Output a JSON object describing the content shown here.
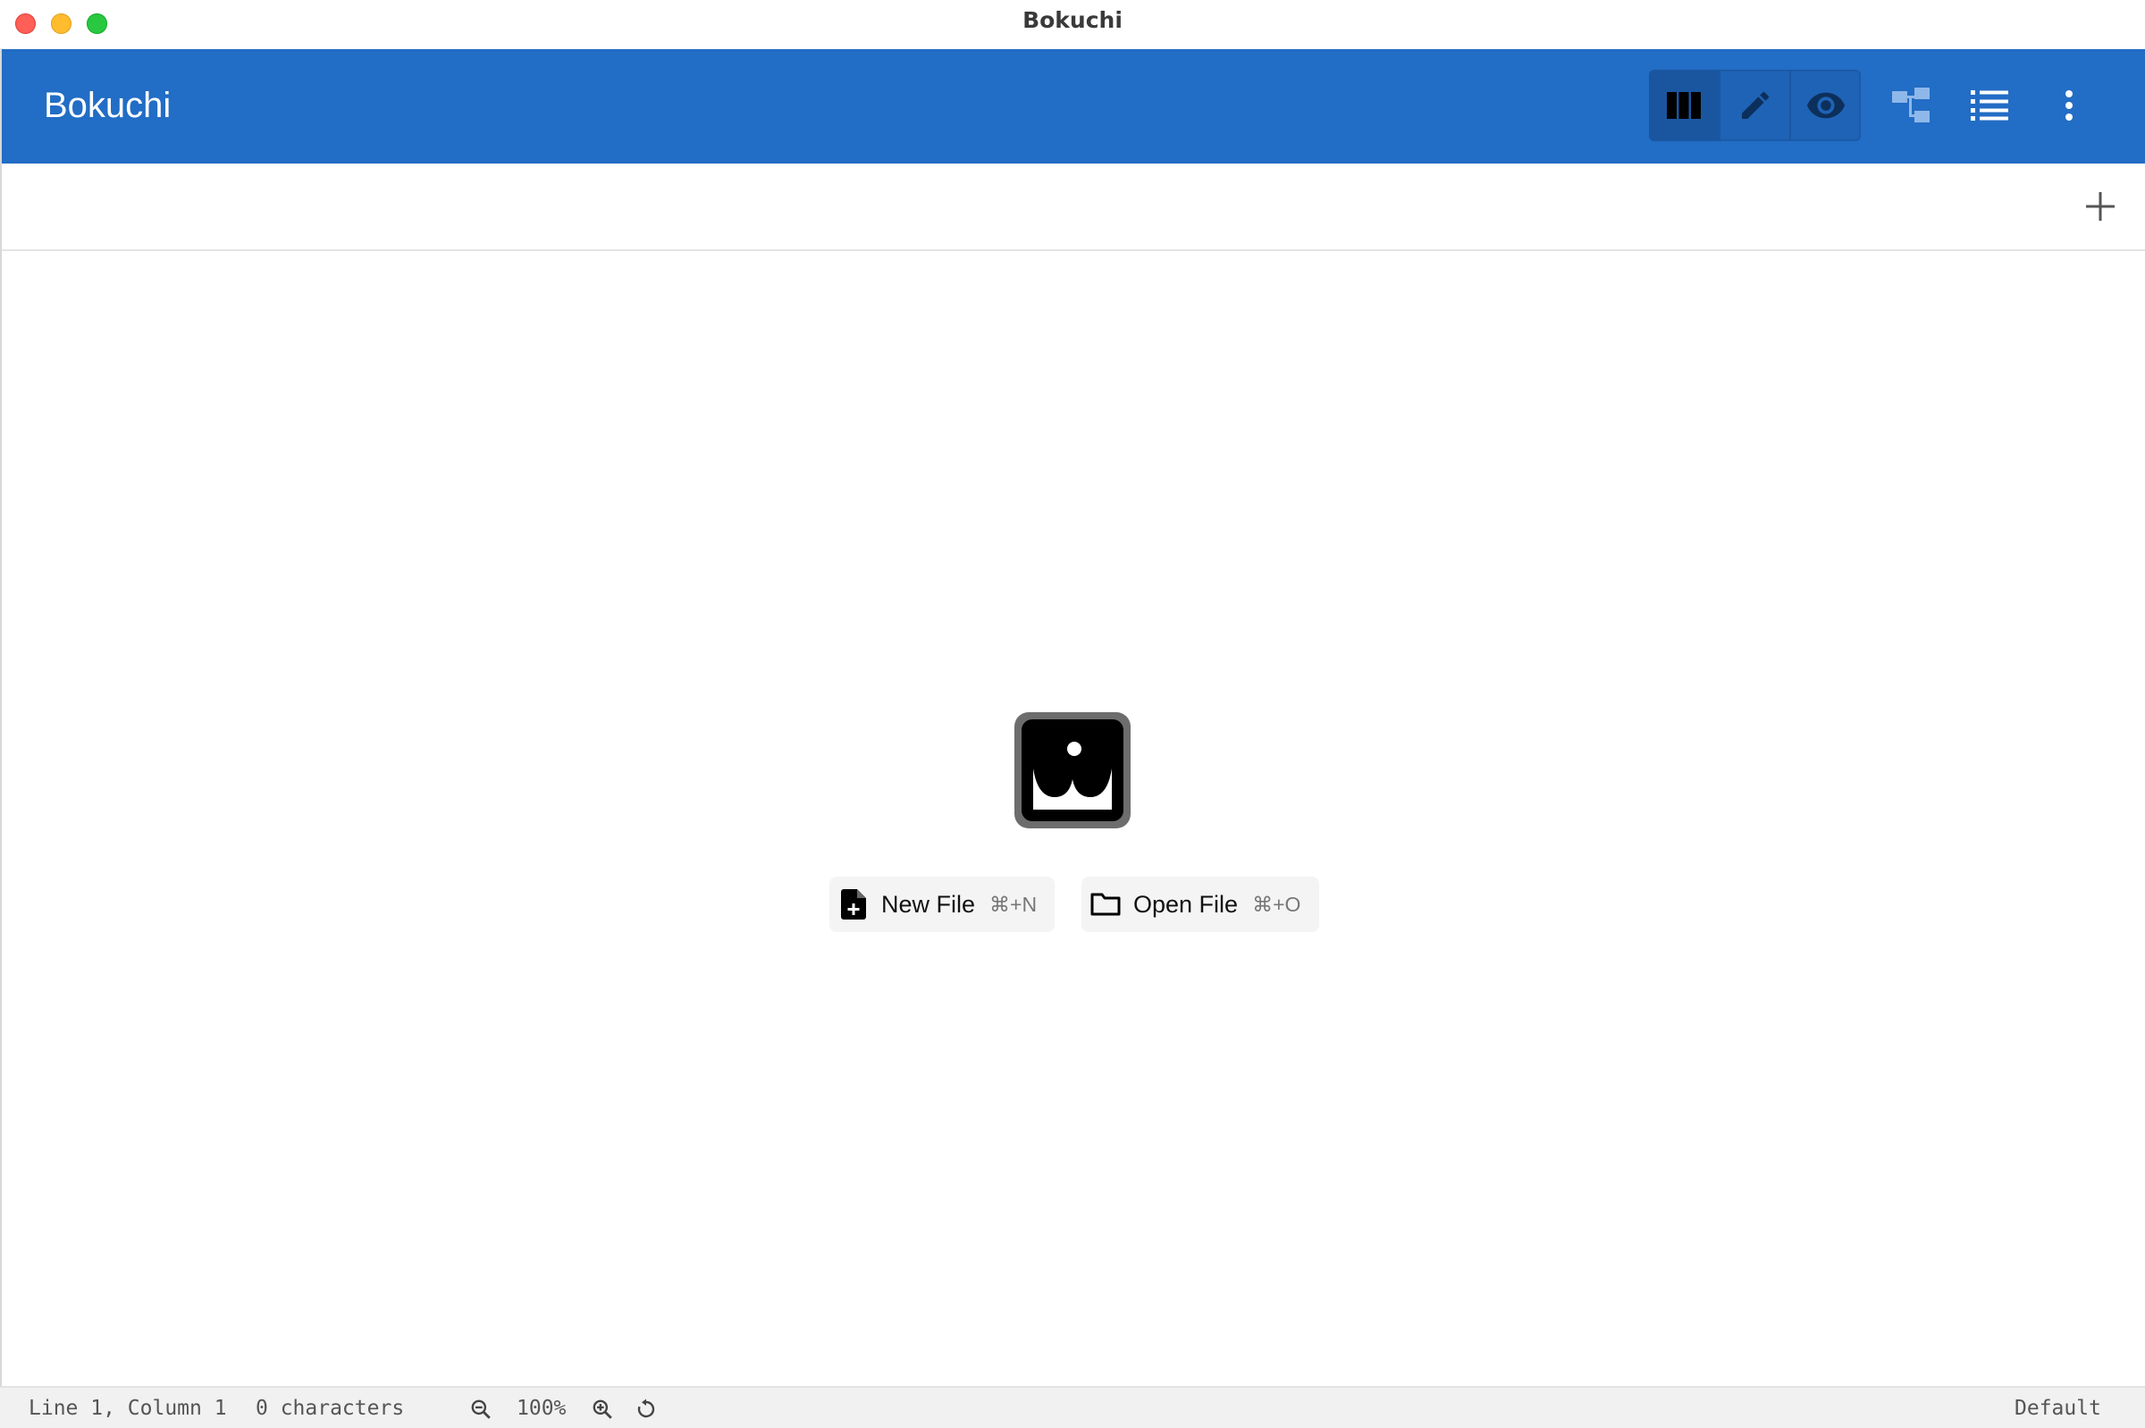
{
  "window": {
    "title": "Bokuchi"
  },
  "toolbar": {
    "app_title": "Bokuchi",
    "view_modes": [
      {
        "name": "split-view",
        "icon": "split-columns-icon",
        "active": true
      },
      {
        "name": "editor-view",
        "icon": "pencil-icon",
        "active": false
      },
      {
        "name": "preview-view",
        "icon": "eye-icon",
        "active": false
      }
    ],
    "actions": [
      {
        "name": "outline-toggle",
        "icon": "tree-structure-icon"
      },
      {
        "name": "table-of-contents",
        "icon": "list-icon"
      },
      {
        "name": "more-menu",
        "icon": "more-vertical-icon"
      }
    ]
  },
  "tabs": {
    "add_icon": "plus-icon"
  },
  "welcome": {
    "logo_icon": "bokuchi-logo-icon",
    "new_file": {
      "label": "New File",
      "shortcut": "⌘+N",
      "icon": "new-file-icon"
    },
    "open_file": {
      "label": "Open File",
      "shortcut": "⌘+O",
      "icon": "folder-icon"
    }
  },
  "status": {
    "position": "Line 1, Column 1",
    "characters": "0 characters",
    "zoom": "100%",
    "theme": "Default"
  },
  "colors": {
    "accent": "#226dc5",
    "accent_dark": "#1a56a0"
  }
}
